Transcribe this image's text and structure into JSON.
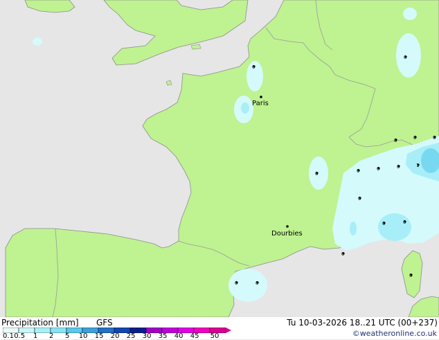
{
  "footer": {
    "title": "Precipitation [mm]",
    "model": "GFS",
    "valid": "Tu 10-03-2026 18..21 UTC (00+237)",
    "credit": "©weatheronline.co.uk"
  },
  "legend": {
    "ticks": [
      "0.1",
      "0.5",
      "1",
      "2",
      "5",
      "10",
      "15",
      "20",
      "25",
      "30",
      "35",
      "40",
      "45",
      "50"
    ],
    "colors": [
      "#e8fcfc",
      "#c8f6f8",
      "#a8f0f8",
      "#88e4f4",
      "#58c8ec",
      "#3ca0dc",
      "#2070c8",
      "#1046b0",
      "#081e8c",
      "#a000c8",
      "#c000d8",
      "#e000e8",
      "#f000c0",
      "#d80090"
    ]
  },
  "colors": {
    "land": "#bff291",
    "sea": "#e6e6e6",
    "border": "#9a9a9a",
    "coast": "#8c8c8c",
    "precip_light": "#d4fafc",
    "precip_medium": "#a8eef8",
    "precip_heavy": "#78d8f0"
  },
  "cities": [
    {
      "name": "Paris"
    },
    {
      "name": "Dourbies"
    }
  ],
  "stations": [
    {
      "label": "0"
    },
    {
      "label": "0"
    },
    {
      "label": "0"
    },
    {
      "label": "0"
    },
    {
      "label": "0"
    },
    {
      "label": "0"
    },
    {
      "label": "0"
    },
    {
      "label": "0"
    },
    {
      "label": "0"
    },
    {
      "label": "1"
    },
    {
      "label": "0"
    },
    {
      "label": "0"
    },
    {
      "label": "0"
    },
    {
      "label": "0"
    },
    {
      "label": "0"
    },
    {
      "label": "0"
    },
    {
      "label": "0"
    }
  ]
}
